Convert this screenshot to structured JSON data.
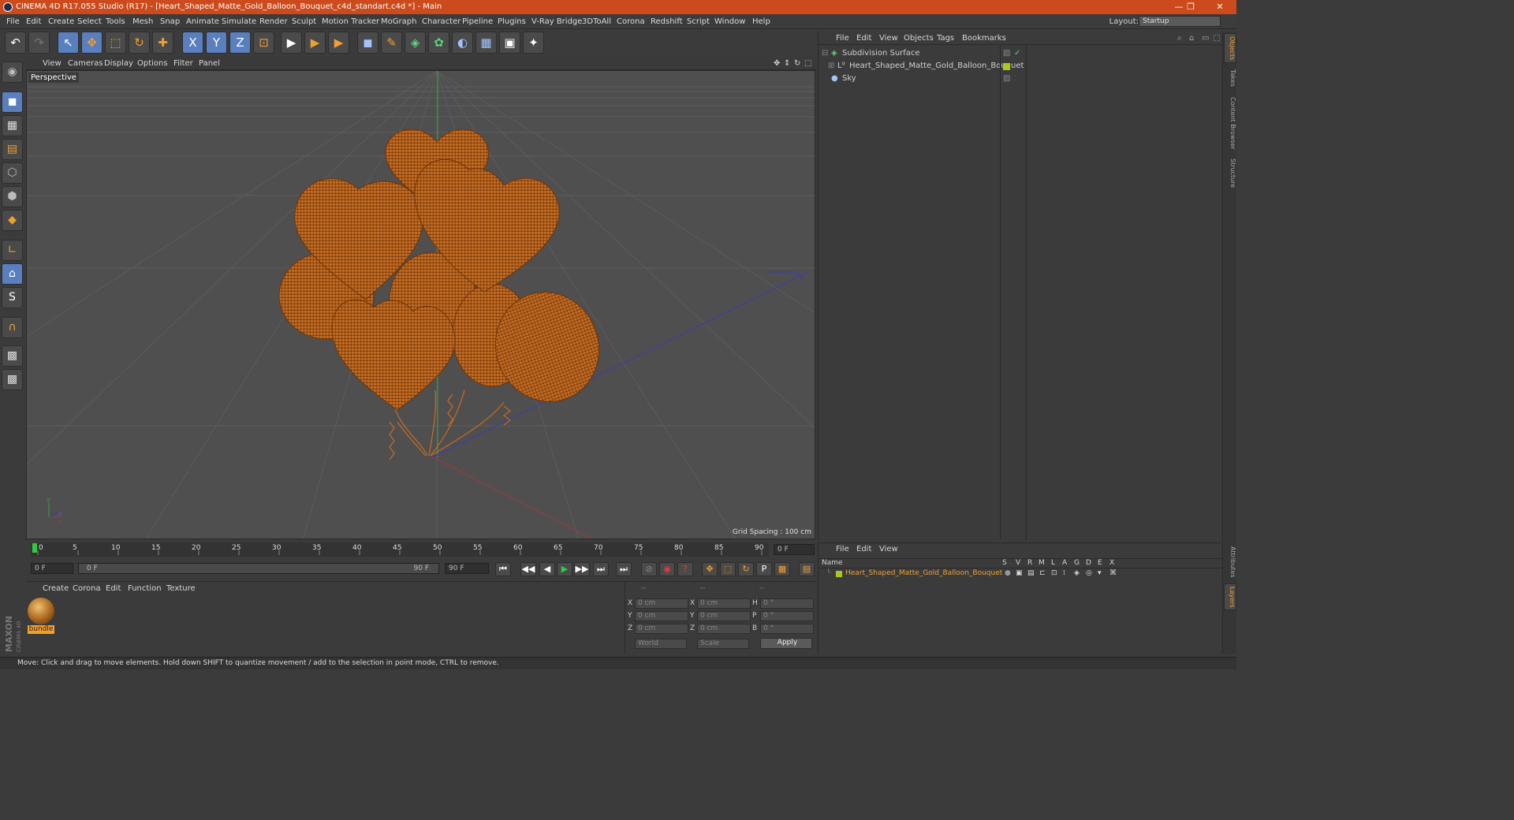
{
  "window": {
    "title": "CINEMA 4D R17.055 Studio (R17) - [Heart_Shaped_Matte_Gold_Balloon_Bouquet_c4d_standart.c4d *] - Main",
    "minimize": "—",
    "restore": "❐",
    "close": "✕"
  },
  "menubar": {
    "items": [
      "File",
      "Edit",
      "Create",
      "Select",
      "Tools",
      "Mesh",
      "Snap",
      "Animate",
      "Simulate",
      "Render",
      "Sculpt",
      "Motion Tracker",
      "MoGraph",
      "Character",
      "Pipeline",
      "Plugins",
      "V-Ray Bridge",
      "3DToAll",
      "Corona",
      "Redshift",
      "Script",
      "Window",
      "Help"
    ],
    "layout_label": "Layout:",
    "layout_value": "Startup"
  },
  "toolbar": {
    "undo": "↶",
    "redo": "↷",
    "select": "↖",
    "move": "✥",
    "scale": "⬚",
    "rotate": "↻",
    "live": "✚",
    "x": "X",
    "y": "Y",
    "z": "Z",
    "coord": "⊡",
    "render1": "▶",
    "render2": "▶",
    "render3": "▶",
    "cube": "◼",
    "pen": "✎",
    "subdiv": "◈",
    "cloner": "✿",
    "deformer": "◐",
    "floor": "▦",
    "camera": "▣",
    "light": "✦"
  },
  "viewport": {
    "menu": [
      "View",
      "Cameras",
      "Display",
      "Options",
      "Filter",
      "Panel"
    ],
    "label": "Perspective",
    "grid_spacing": "Grid Spacing : 100 cm",
    "nav_icons": [
      "✥",
      "⇕",
      "↻",
      "⬚"
    ],
    "axis_y": "y",
    "axis_x": "x",
    "axis_z": "z"
  },
  "timeline": {
    "ticks": [
      "0",
      "5",
      "10",
      "15",
      "20",
      "25",
      "30",
      "35",
      "40",
      "45",
      "50",
      "55",
      "60",
      "65",
      "70",
      "75",
      "80",
      "85",
      "90"
    ],
    "current_frame": "0 F"
  },
  "timectrl": {
    "start": "0 F",
    "range_start": "0 F",
    "range_end": "90 F",
    "end": "90 F",
    "buttons": [
      "⏮",
      "◀◀",
      "◀",
      "▶",
      "▶▶",
      "⏭"
    ]
  },
  "material_manager": {
    "menu": [
      "Create",
      "Corona",
      "Edit",
      "Function",
      "Texture"
    ],
    "material_name": "bundle"
  },
  "coordinates": {
    "header": [
      "--",
      "--",
      "--"
    ],
    "rows": [
      {
        "a": "X",
        "av": "0 cm",
        "b": "X",
        "bv": "0 cm",
        "c": "H",
        "cv": "0 °"
      },
      {
        "a": "Y",
        "av": "0 cm",
        "b": "Y",
        "bv": "0 cm",
        "c": "P",
        "cv": "0 °"
      },
      {
        "a": "Z",
        "av": "0 cm",
        "b": "Z",
        "bv": "0 cm",
        "c": "B",
        "cv": "0 °"
      }
    ],
    "mode1": "World",
    "mode2": "Scale",
    "apply": "Apply"
  },
  "object_manager": {
    "menu": [
      "File",
      "Edit",
      "View",
      "Objects",
      "Tags",
      "Bookmarks"
    ],
    "objects": [
      {
        "name": "Subdivision Surface"
      },
      {
        "name": "Heart_Shaped_Matte_Gold_Balloon_Bouquet"
      },
      {
        "name": "Sky"
      }
    ]
  },
  "layer_manager": {
    "menu": [
      "File",
      "Edit",
      "View"
    ],
    "name_header": "Name",
    "col_headers": [
      "S",
      "V",
      "R",
      "M",
      "L",
      "A",
      "G",
      "D",
      "E",
      "X"
    ],
    "layer_name": "Heart_Shaped_Matte_Gold_Balloon_Bouquet"
  },
  "right_tabs": [
    "Objects",
    "Takes",
    "Content Browser",
    "Structure",
    "Attributes",
    "Layers"
  ],
  "statusbar": {
    "text": "Move: Click and drag to move elements. Hold down SHIFT to quantize movement / add to the selection in point mode, CTRL to remove."
  },
  "brand": {
    "maxon": "MAXON",
    "c4d": "CINEMA 4D"
  },
  "colors": {
    "accent": "#cc4a1b",
    "balloon": "#b8621f",
    "balloon_dark": "#7a3c10",
    "selected_blue": "#5a7fbf",
    "layer_green": "#a8c820"
  }
}
